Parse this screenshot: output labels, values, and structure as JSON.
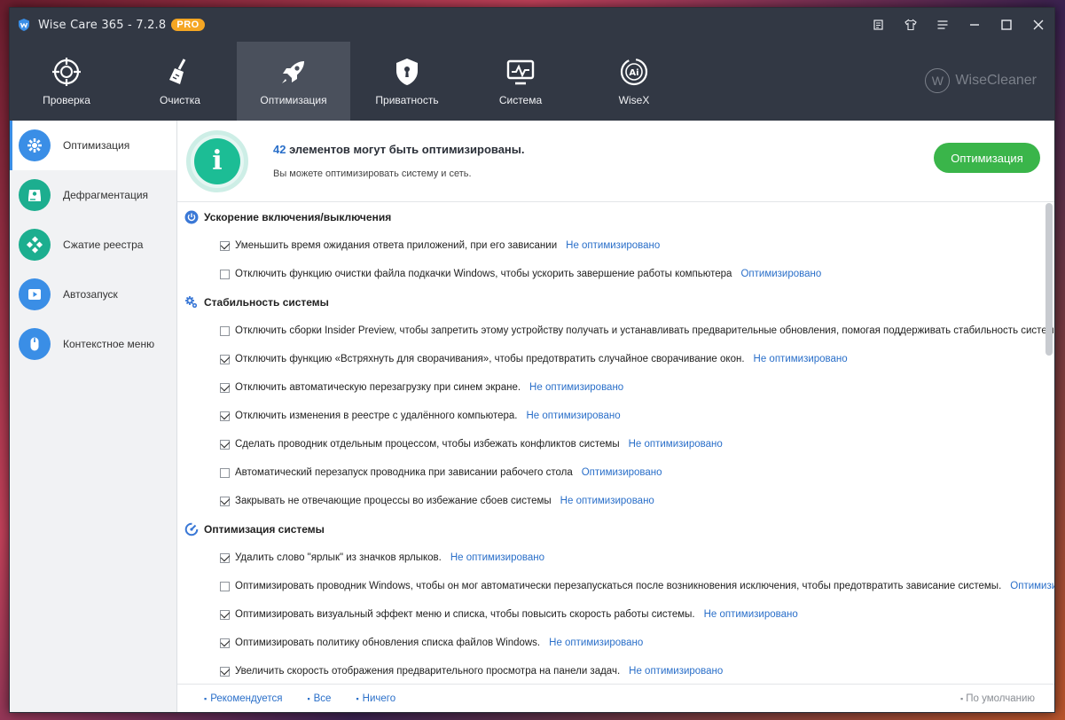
{
  "window": {
    "title": "Wise Care 365 - 7.2.8",
    "badge": "PRO"
  },
  "topnav": {
    "tabs": [
      {
        "label": "Проверка",
        "icon": "target-icon"
      },
      {
        "label": "Очистка",
        "icon": "broom-icon"
      },
      {
        "label": "Оптимизация",
        "icon": "rocket-icon",
        "active": true
      },
      {
        "label": "Приватность",
        "icon": "shield-lock-icon"
      },
      {
        "label": "Система",
        "icon": "monitor-icon"
      },
      {
        "label": "WiseX",
        "icon": "ai-icon"
      }
    ],
    "brand": "WiseCleaner",
    "brand_mark": "W"
  },
  "sidebar": {
    "items": [
      {
        "label": "Оптимизация",
        "icon": "gear-icon",
        "color": "#3a8ee6",
        "active": true
      },
      {
        "label": "Дефрагментация",
        "icon": "disk-icon",
        "color": "#1cae8f"
      },
      {
        "label": "Сжатие реестра",
        "icon": "registry-icon",
        "color": "#1cae8f"
      },
      {
        "label": "Автозапуск",
        "icon": "play-icon",
        "color": "#3a8ee6"
      },
      {
        "label": "Контекстное меню",
        "icon": "mouse-icon",
        "color": "#3a8ee6"
      }
    ]
  },
  "summary": {
    "count": "42",
    "title_rest": " элементов могут быть оптимизированы.",
    "subtitle": "Вы можете оптимизировать систему и сеть.",
    "button": "Оптимизация",
    "info_glyph": "i"
  },
  "sections": [
    {
      "title": "Ускорение включения/выключения",
      "icon": "power-icon",
      "rows": [
        {
          "text": "Уменьшить время ожидания ответа приложений, при его зависании",
          "status": "Не оптимизировано",
          "checked": true
        },
        {
          "text": "Отключить функцию очистки файла подкачки Windows, чтобы ускорить завершение работы компьютера",
          "status": "Оптимизировано",
          "checked": false
        }
      ]
    },
    {
      "title": "Стабильность системы",
      "icon": "gears-icon",
      "rows": [
        {
          "text": "Отключить сборки Insider Preview, чтобы запретить этому устройству получать и устанавливать предварительные обновления, помогая поддерживать стабильность системы.",
          "status": "",
          "checked": false
        },
        {
          "text": "Отключить функцию «Встряхнуть для сворачивания», чтобы предотвратить случайное сворачивание окон.",
          "status": "Не оптимизировано",
          "checked": true
        },
        {
          "text": "Отключить автоматическую перезагрузку при синем экране.",
          "status": "Не оптимизировано",
          "checked": true
        },
        {
          "text": "Отключить изменения в реестре с удалённого компьютера.",
          "status": "Не оптимизировано",
          "checked": true
        },
        {
          "text": "Сделать проводник отдельным процессом, чтобы избежать конфликтов системы",
          "status": "Не оптимизировано",
          "checked": true
        },
        {
          "text": "Автоматический перезапуск проводника при зависании рабочего стола",
          "status": "Оптимизировано",
          "checked": false
        },
        {
          "text": "Закрывать не отвечающие процессы во избежание сбоев системы",
          "status": "Не оптимизировано",
          "checked": true
        }
      ]
    },
    {
      "title": "Оптимизация системы",
      "icon": "gauge-icon",
      "rows": [
        {
          "text": "Удалить слово \"ярлык\" из значков ярлыков.",
          "status": "Не оптимизировано",
          "checked": true
        },
        {
          "text": "Оптимизировать проводник Windows, чтобы он мог автоматически перезапускаться после возникновения исключения, чтобы предотвратить зависание системы.",
          "status": "Оптимизир...",
          "checked": false
        },
        {
          "text": "Оптимизировать визуальный эффект меню и списка, чтобы повысить скорость работы системы.",
          "status": "Не оптимизировано",
          "checked": true
        },
        {
          "text": "Оптимизировать политику обновления списка файлов Windows.",
          "status": "Не оптимизировано",
          "checked": true
        },
        {
          "text": "Увеличить скорость отображения предварительного просмотра на панели задач.",
          "status": "Не оптимизировано",
          "checked": true
        }
      ]
    }
  ],
  "footer": {
    "recommended": "Рекомендуется",
    "all": "Все",
    "none": "Ничего",
    "default": "По умолчанию"
  }
}
